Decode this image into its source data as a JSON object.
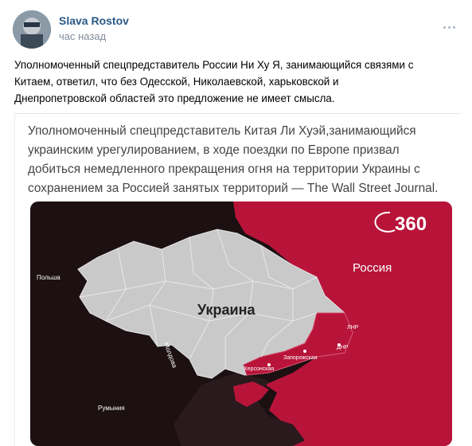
{
  "post": {
    "author": "Slava Rostov",
    "time": "час назад",
    "text_lines": [
      "Уполномоченный спецпредставитель России Ни Ху Я, занимающийся связями с",
      "Китаем, ответил, что без Одесской, Николаевской, харьковской и",
      "Днепропетровской областей это предложение не имеет смысла."
    ]
  },
  "card": {
    "quote_lines": [
      "Уполномоченный спецпредставитель Китая Ли Хуэй,занимающийся",
      "украинским урегулированием, в ходе поездки по Европе призвал",
      "добиться немедленного прекращения огня на территории Украины с",
      "сохранением за Россией занятых территорий — The Wall Street Journal."
    ]
  },
  "map": {
    "logo": "360",
    "labels": {
      "ukraine": "Украина",
      "russia": "Россия",
      "poland": "Польша",
      "moldova": "Молдова",
      "romania": "Румыния",
      "lnr": "ЛНР",
      "dnr": "ДНР",
      "zaporozhye": "Запорожская",
      "kherson": "Херсонская"
    },
    "colors": {
      "russia": "#b8143a",
      "ukraine": "#c9c9c9",
      "dark": "#1c1012",
      "sea": "#2a1a1d"
    }
  },
  "icons": {
    "menu": "more-dots-icon"
  }
}
